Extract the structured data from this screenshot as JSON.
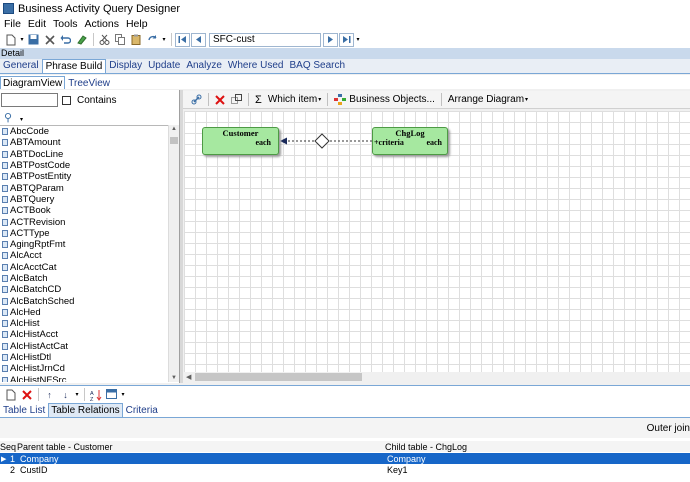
{
  "window": {
    "title": "Business Activity Query Designer"
  },
  "menu": [
    "File",
    "Edit",
    "Tools",
    "Actions",
    "Help"
  ],
  "toolbar": {
    "record_id": "SFC-cust"
  },
  "detail_label": "Detail",
  "main_tabs": [
    "General",
    "Phrase Build",
    "Display",
    "Update",
    "Analyze",
    "Where Used",
    "BAQ Search"
  ],
  "sub_tabs": [
    "DiagramView",
    "TreeView"
  ],
  "left_panel": {
    "search_value": "",
    "contains_label": "Contains",
    "tables": [
      "AbcCode",
      "ABTAmount",
      "ABTDocLine",
      "ABTPostCode",
      "ABTPostEntity",
      "ABTQParam",
      "ABTQuery",
      "ACTBook",
      "ACTRevision",
      "ACTType",
      "AgingRptFmt",
      "AlcAcct",
      "AlcAcctCat",
      "AlcBatch",
      "AlcBatchCD",
      "AlcBatchSched",
      "AlcHed",
      "AlcHist",
      "AlcHistAcct",
      "AlcHistActCat",
      "AlcHistDtl",
      "AlcHistJrnCd",
      "AlcHistNFSrc"
    ]
  },
  "diagram_toolbar": {
    "which_item": "Which item",
    "business_objects": "Business Objects...",
    "arrange_diagram": "Arrange Diagram"
  },
  "diagram": {
    "nodes": [
      {
        "title": "Customer",
        "each": "each"
      },
      {
        "title": "ChgLog",
        "criteria": "+criteria",
        "each": "each"
      }
    ]
  },
  "bottom_tabs": [
    "Table List",
    "Table Relations",
    "Criteria"
  ],
  "outer_join_label": "Outer join",
  "relations_grid": {
    "columns": {
      "seq": "Seq",
      "parent": "Parent table - Customer",
      "child": "Child table - ChgLog"
    },
    "rows": [
      {
        "seq": "1",
        "parent": "Company",
        "child": "Company"
      },
      {
        "seq": "2",
        "parent": "CustID",
        "child": "Key1"
      }
    ]
  },
  "colors": {
    "node_fill": "#a6e8a0",
    "selection": "#1666c8",
    "tab_accent": "#7aa7d6"
  }
}
